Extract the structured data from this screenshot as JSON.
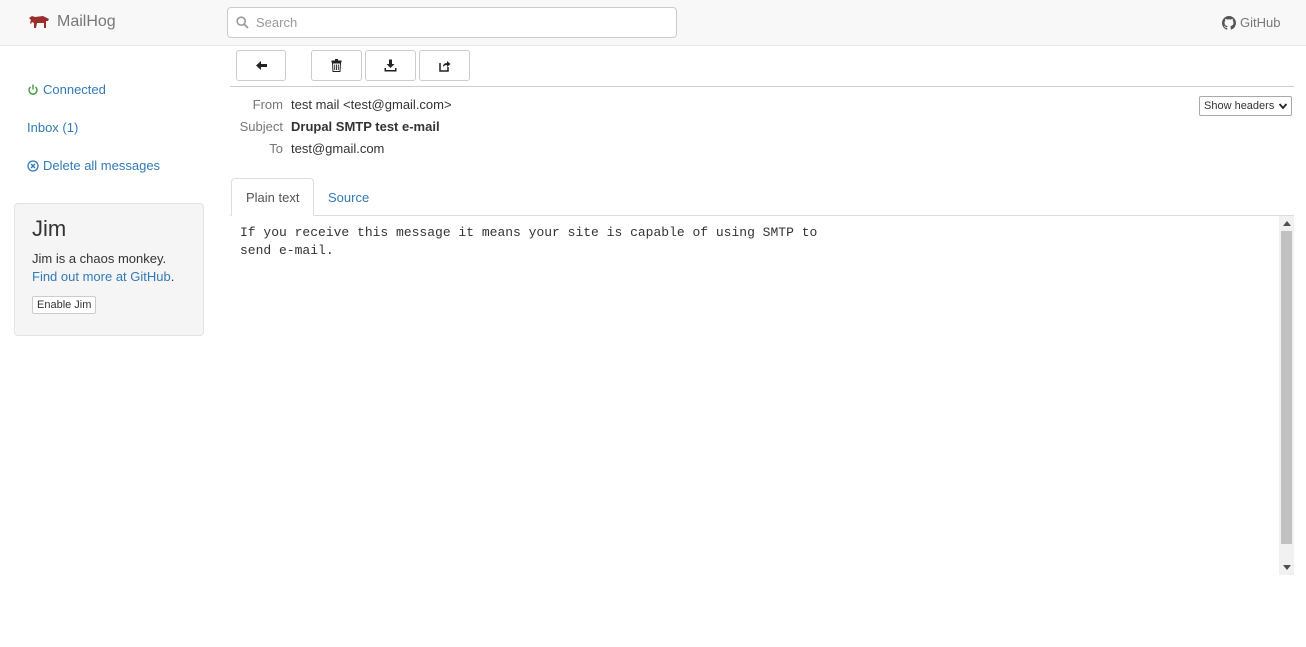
{
  "navbar": {
    "brand": "MailHog",
    "search_placeholder": "Search",
    "github": "GitHub"
  },
  "sidebar": {
    "connected": "Connected",
    "inbox": "Inbox (1)",
    "delete_all": "Delete all messages",
    "jim": {
      "title": "Jim",
      "desc": "Jim is a chaos monkey.",
      "link": "Find out more at GitHub",
      "link_suffix": ".",
      "button": "Enable Jim"
    }
  },
  "toolbar": {
    "icons": [
      "arrow-left-icon",
      "trash-icon",
      "download-icon",
      "share-icon"
    ]
  },
  "message": {
    "from_label": "From",
    "from": "test mail <test@gmail.com>",
    "subject_label": "Subject",
    "subject": "Drupal SMTP test e-mail",
    "to_label": "To",
    "to": "test@gmail.com",
    "show_headers": "Show headers",
    "tabs": [
      "Plain text",
      "Source"
    ],
    "active_tab": "Plain text",
    "body_line1": "If you receive this message it means your site is capable of using SMTP to",
    "body_line2": "send e-mail."
  },
  "colors": {
    "link": "#337ab7",
    "connected": "#3c9a3c",
    "brand_icon": "#9b2d2d"
  }
}
